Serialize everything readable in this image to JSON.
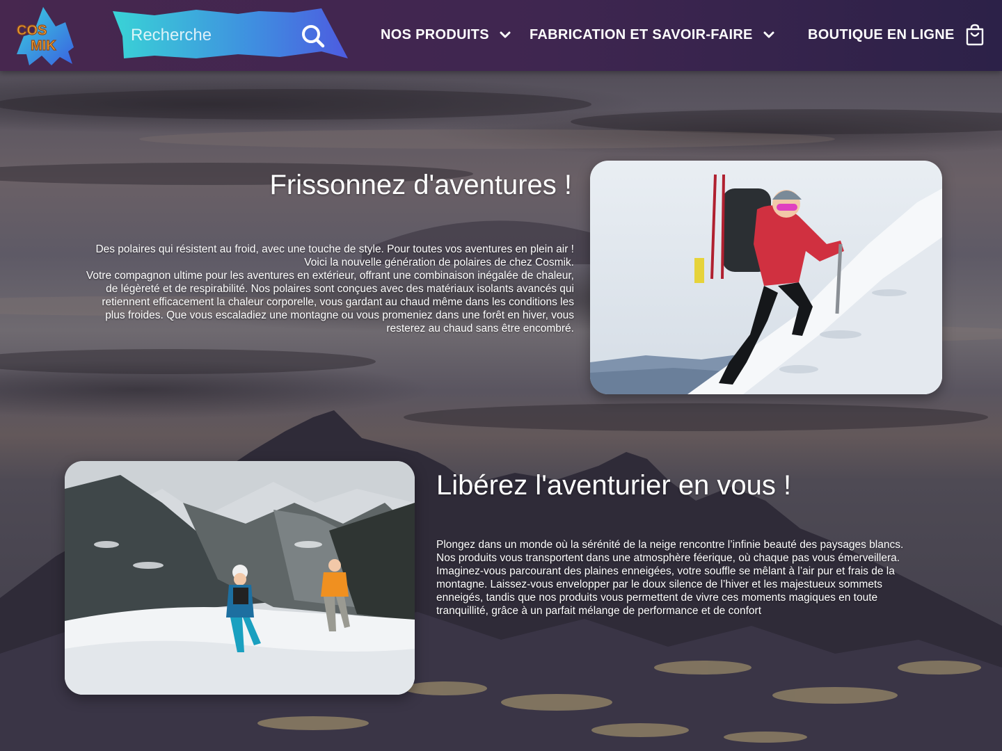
{
  "header": {
    "logo_text": [
      "COS",
      "MIK"
    ],
    "search": {
      "placeholder": "Recherche"
    },
    "nav": [
      {
        "label": "NOS PRODUITS",
        "icon": "chevron-down-icon"
      },
      {
        "label": "FABRICATION ET SAVOIR-FAIRE",
        "icon": "chevron-down-icon"
      },
      {
        "label": "BOUTIQUE EN LIGNE",
        "icon": "cart-icon"
      }
    ]
  },
  "section1": {
    "title": "Frissonnez d'aventures !",
    "lines": [
      "Des polaires qui résistent au froid, avec une touche de style. Pour toutes vos aventures en plein air !",
      "Voici la nouvelle génération de polaires de chez Cosmik.",
      "Votre compagnon ultime pour les aventures en extérieur, offrant une combinaison inégalée de chaleur,",
      "de légèreté et de respirabilité. Nos polaires sont conçues avec des matériaux isolants avancés qui",
      "retiennent efficacement la chaleur corporelle, vous gardant au chaud même dans les conditions les",
      "plus froides. Que vous escaladiez une montagne ou vous promeniez dans une forêt en hiver, vous",
      "resterez au chaud sans être encombré."
    ]
  },
  "section2": {
    "title": "Libérez l'aventurier en vous !",
    "lines": [
      "Plongez dans un monde où la sérénité de la neige rencontre l’infinie beauté des paysages blancs.",
      "Nos produits vous transportent dans une atmosphère féerique, où chaque pas vous émerveillera.",
      "Imaginez-vous parcourant des plaines enneigées, votre souffle se mêlant à l’air pur et frais de la",
      "montagne. Laissez-vous envelopper par le doux silence de l’hiver et les majestueux sommets",
      "enneigés, tandis que nos produits vous permettent de vivre ces moments magiques en toute",
      "tranquillité, grâce à un parfait mélange de performance et de confort"
    ]
  },
  "colors": {
    "header_start": "#47274f",
    "header_end": "#2c2148",
    "search_gradient_start": "#39d3d6",
    "search_gradient_end": "#4d5be0",
    "text": "#ffffff"
  }
}
